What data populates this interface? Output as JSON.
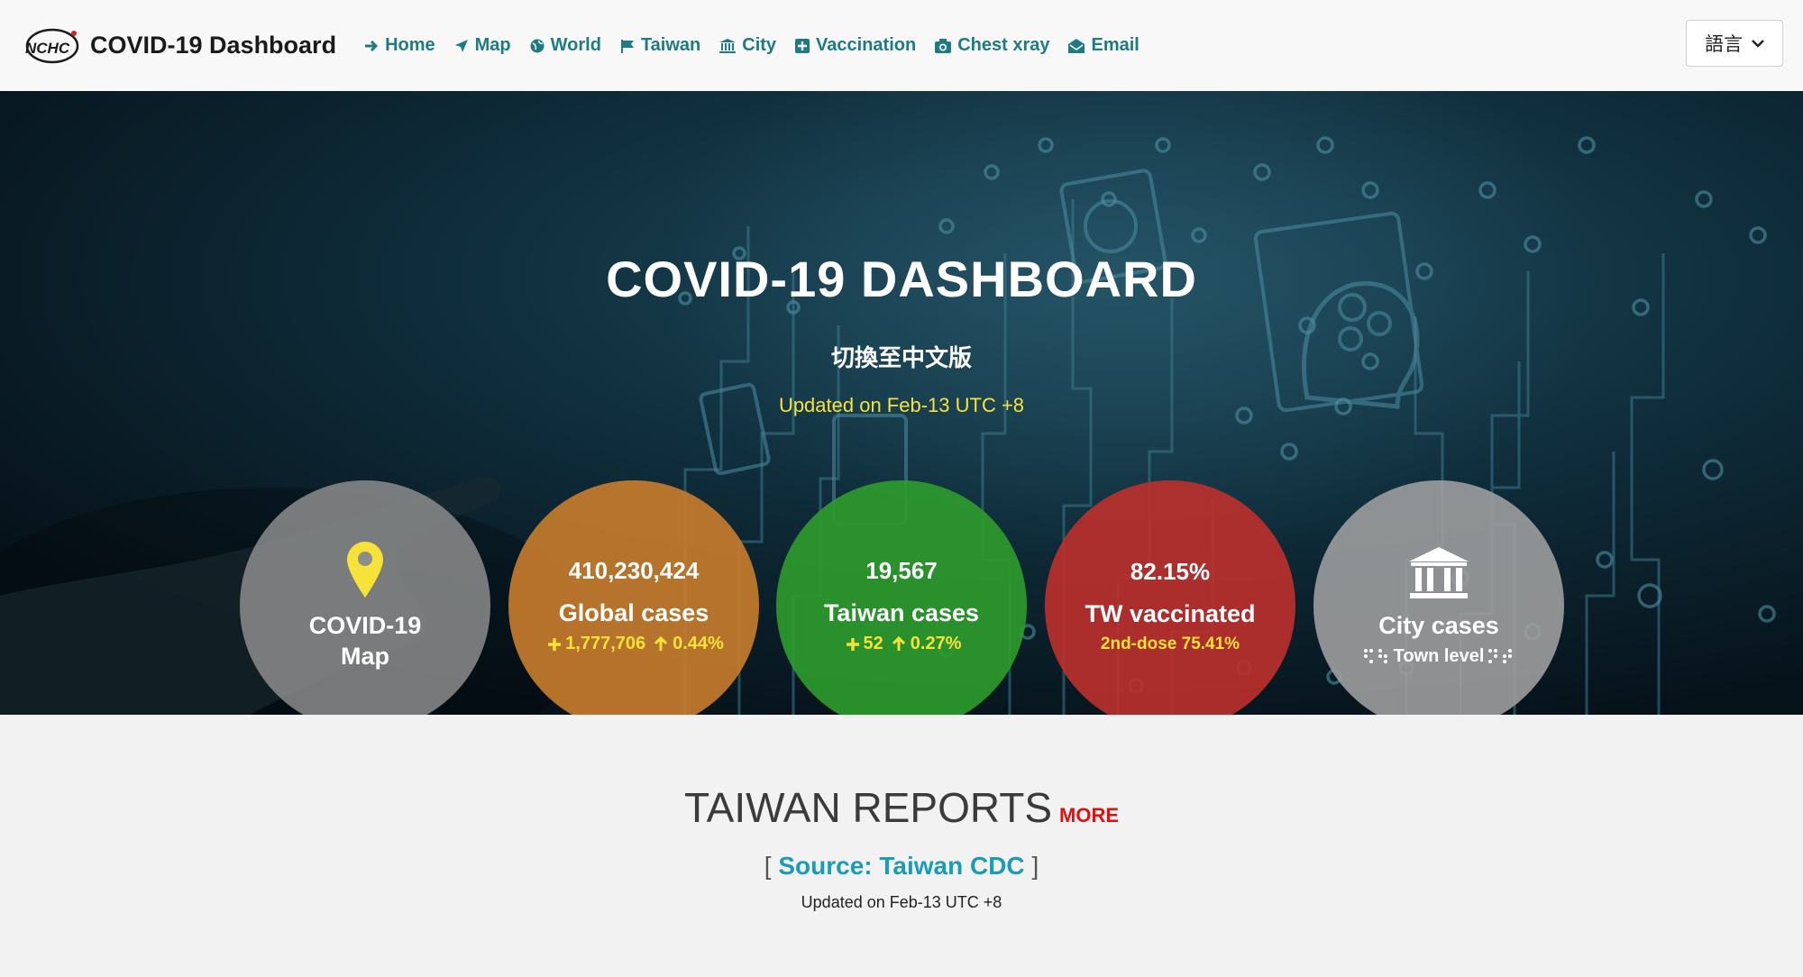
{
  "nav": {
    "brand_title": "COVID-19 Dashboard",
    "logo_text": "NCHC",
    "items": [
      {
        "label": "Home",
        "icon": "arrow-right-icon"
      },
      {
        "label": "Map",
        "icon": "plane-icon"
      },
      {
        "label": "World",
        "icon": "globe-icon"
      },
      {
        "label": "Taiwan",
        "icon": "flag-icon"
      },
      {
        "label": "City",
        "icon": "bank-icon"
      },
      {
        "label": "Vaccination",
        "icon": "plus-square-icon"
      },
      {
        "label": "Chest xray",
        "icon": "camera-icon"
      },
      {
        "label": "Email",
        "icon": "envelope-icon"
      }
    ],
    "language_select": "語言"
  },
  "hero": {
    "title": "COVID-19 DASHBOARD",
    "switch_language": "切換至中文版",
    "updated": "Updated on Feb-13 UTC +8"
  },
  "cards": {
    "map": {
      "label_line1": "COVID-19",
      "label_line2": "Map",
      "icon": "map-marker-icon",
      "color": "#8a8a8a"
    },
    "global": {
      "number": "410,230,424",
      "label": "Global cases",
      "increase": "1,777,706",
      "percent": "0.44%",
      "color": "#c47b2c"
    },
    "taiwan": {
      "number": "19,567",
      "label": "Taiwan cases",
      "increase": "52",
      "percent": "0.27%",
      "color": "#2e9a2e"
    },
    "vaccinated": {
      "number": "82.15%",
      "label": "TW vaccinated",
      "sub": "2nd-dose 75.41%",
      "color": "#b8302d"
    },
    "city": {
      "label": "City cases",
      "sub": "Town level",
      "icon": "bank-icon",
      "color": "#9a9a9a"
    }
  },
  "reports": {
    "title": "TAIWAN REPORTS",
    "more": "MORE",
    "bracket_open": "[",
    "source": "Source: Taiwan CDC",
    "bracket_close": "]",
    "updated": "Updated on Feb-13 UTC +8"
  },
  "colors": {
    "nav_link": "#1e7b84",
    "highlight_yellow": "#f7e23a",
    "more_red": "#e01010",
    "source_link": "#1a9bb7"
  }
}
